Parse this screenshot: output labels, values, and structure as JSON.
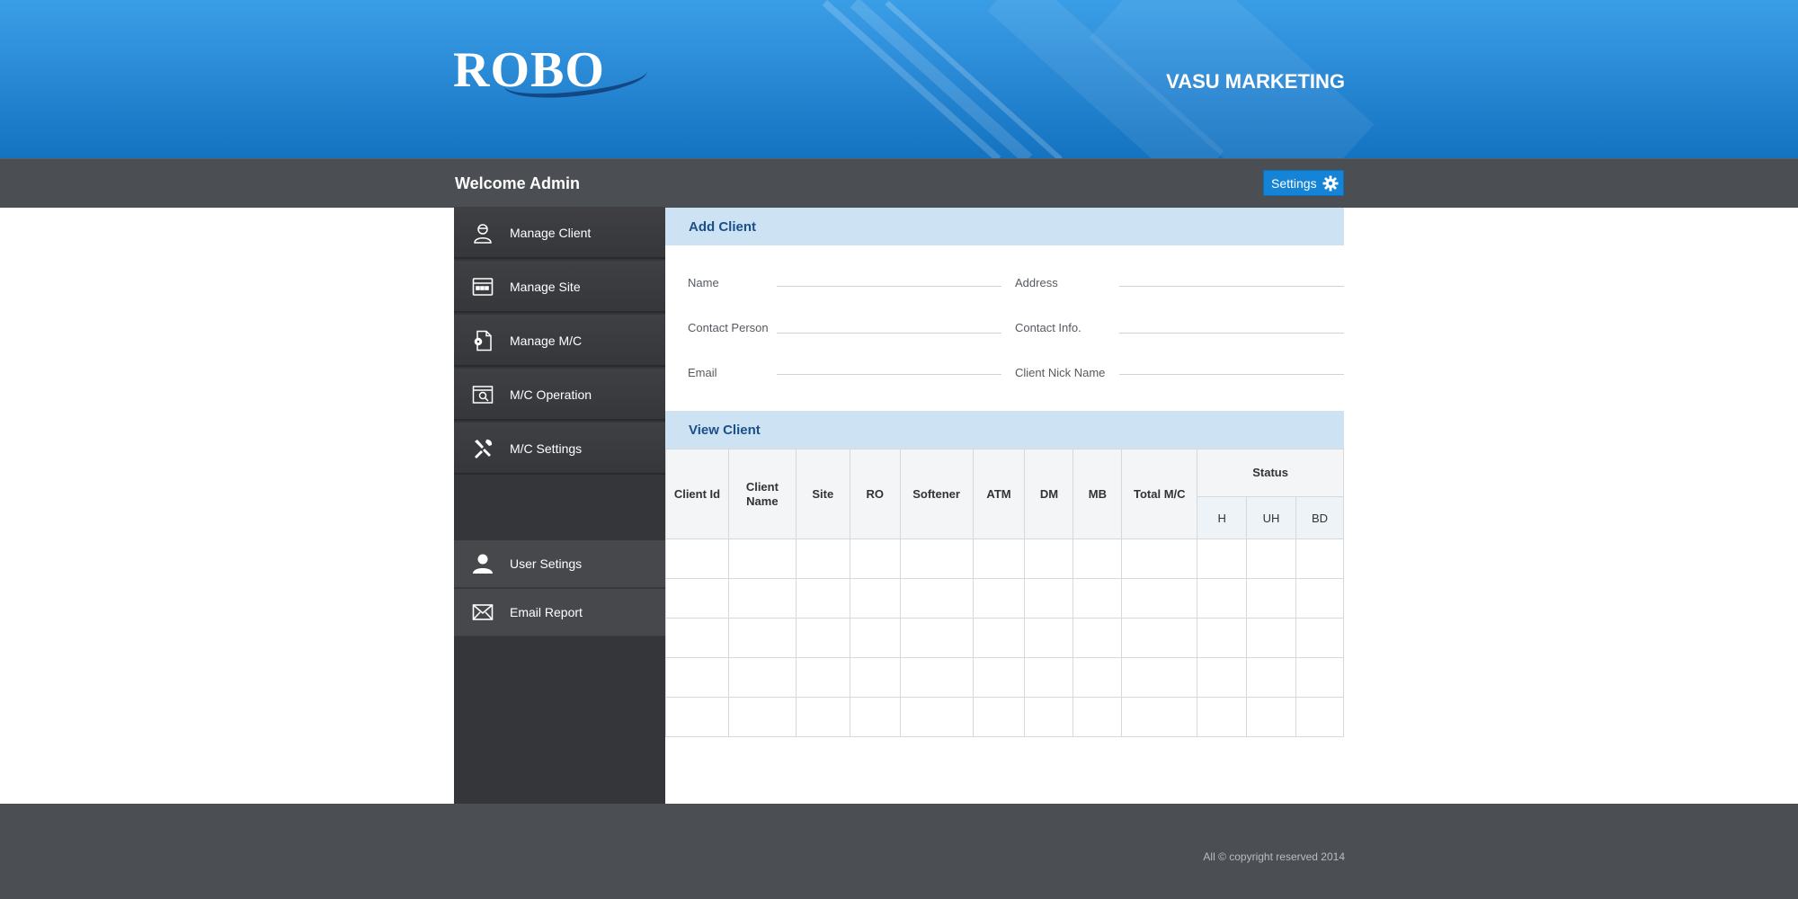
{
  "header": {
    "logo": "ROBO",
    "company": "VASU MARKETING"
  },
  "topbar": {
    "welcome": "Welcome  Admin",
    "settings_label": "Settings"
  },
  "sidebar": {
    "items": [
      {
        "label": "Manage Client",
        "icon": "user-icon"
      },
      {
        "label": "Manage Site",
        "icon": "window-icon"
      },
      {
        "label": "Manage M/C",
        "icon": "document-gear-icon"
      },
      {
        "label": "M/C Operation",
        "icon": "window-search-icon"
      },
      {
        "label": "M/C Settings",
        "icon": "tools-icon"
      }
    ],
    "bottom_items": [
      {
        "label": "User Setings",
        "icon": "person-icon"
      },
      {
        "label": "Email Report",
        "icon": "envelope-icon"
      }
    ]
  },
  "add_client": {
    "title": "Add Client",
    "fields": {
      "name": "Name",
      "address": "Address",
      "contact_person": "Contact Person",
      "contact_info": "Contact Info.",
      "email": "Email",
      "nick_name": "Client Nick Name"
    }
  },
  "view_client": {
    "title": "View Client",
    "columns": [
      "Client Id",
      "Client Name",
      "Site",
      "RO",
      "Softener",
      "ATM",
      "DM",
      "MB",
      "Total M/C",
      "Status"
    ],
    "status_sub": [
      "H",
      "UH",
      "BD"
    ]
  },
  "footer": {
    "copyright": "All © copyright reserved 2014"
  }
}
